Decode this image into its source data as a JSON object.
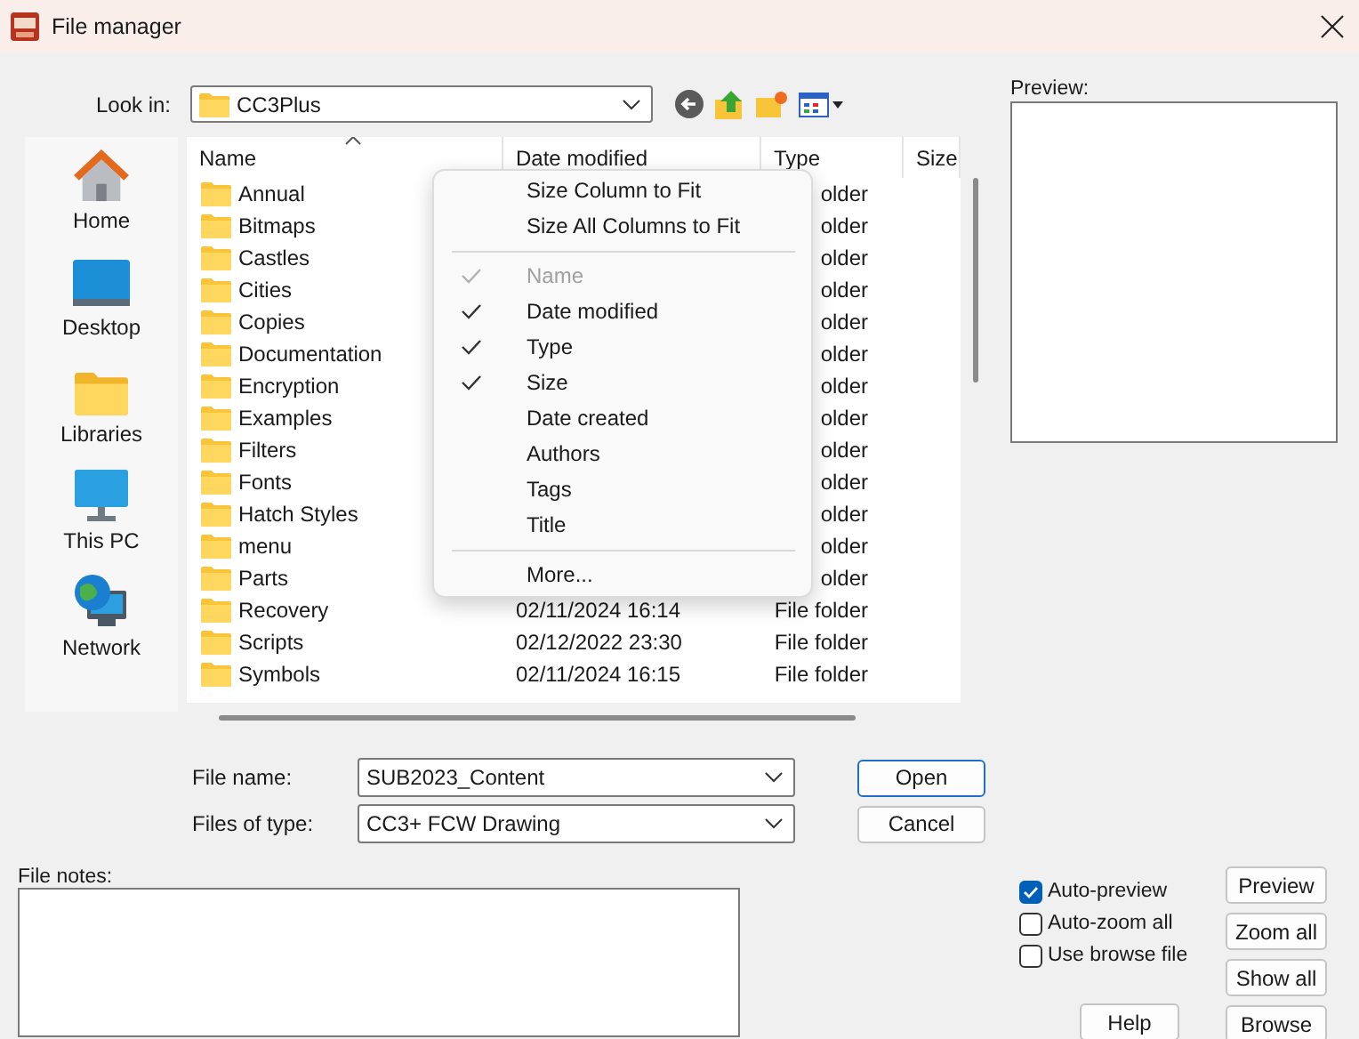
{
  "window": {
    "title": "File manager"
  },
  "look_in": {
    "label": "Look in:",
    "value": "CC3Plus"
  },
  "preview": {
    "label": "Preview:"
  },
  "places": [
    {
      "kind": "home",
      "label": "Home"
    },
    {
      "kind": "desktop",
      "label": "Desktop"
    },
    {
      "kind": "libraries",
      "label": "Libraries"
    },
    {
      "kind": "pc",
      "label": "This PC"
    },
    {
      "kind": "network",
      "label": "Network"
    }
  ],
  "file_list": {
    "columns": [
      {
        "label": "Name",
        "sorted": true
      },
      {
        "label": "Date modified",
        "sorted": false
      },
      {
        "label": "Type",
        "sorted": false
      },
      {
        "label": "Size",
        "sorted": false
      }
    ],
    "rows": [
      {
        "name": "Annual",
        "type": "older"
      },
      {
        "name": "Bitmaps",
        "type": "older"
      },
      {
        "name": "Castles",
        "type": "older"
      },
      {
        "name": "Cities",
        "type": "older"
      },
      {
        "name": "Copies",
        "type": "older"
      },
      {
        "name": "Documentation",
        "type": "older"
      },
      {
        "name": "Encryption",
        "type": "older"
      },
      {
        "name": "Examples",
        "type": "older"
      },
      {
        "name": "Filters",
        "type": "older"
      },
      {
        "name": "Fonts",
        "type": "older"
      },
      {
        "name": "Hatch Styles",
        "type": "older"
      },
      {
        "name": "menu",
        "type": "older"
      },
      {
        "name": "Parts",
        "type": "older"
      },
      {
        "name": "Recovery",
        "date": "02/11/2024 16:14",
        "type": "File folder"
      },
      {
        "name": "Scripts",
        "date": "02/12/2022 23:30",
        "type": "File folder"
      },
      {
        "name": "Symbols",
        "date": "02/11/2024 16:15",
        "type": "File folder"
      }
    ]
  },
  "context_menu": {
    "items": [
      {
        "kind": "action",
        "label": "Size Column to Fit"
      },
      {
        "kind": "action",
        "label": "Size All Columns to Fit"
      },
      {
        "kind": "separator"
      },
      {
        "kind": "toggle",
        "label": "Name",
        "checked": true,
        "disabled": true
      },
      {
        "kind": "toggle",
        "label": "Date modified",
        "checked": true,
        "disabled": false
      },
      {
        "kind": "toggle",
        "label": "Type",
        "checked": true,
        "disabled": false
      },
      {
        "kind": "toggle",
        "label": "Size",
        "checked": true,
        "disabled": false
      },
      {
        "kind": "toggle",
        "label": "Date created",
        "checked": false,
        "disabled": false
      },
      {
        "kind": "toggle",
        "label": "Authors",
        "checked": false,
        "disabled": false
      },
      {
        "kind": "toggle",
        "label": "Tags",
        "checked": false,
        "disabled": false
      },
      {
        "kind": "toggle",
        "label": "Title",
        "checked": false,
        "disabled": false
      },
      {
        "kind": "separator"
      },
      {
        "kind": "action",
        "label": "More..."
      }
    ]
  },
  "file_name": {
    "label": "File name:",
    "value": "SUB2023_Content"
  },
  "file_type": {
    "label": "Files of type:",
    "value": "CC3+ FCW Drawing"
  },
  "dialog_buttons": [
    {
      "label": "Open",
      "default": true
    },
    {
      "label": "Cancel",
      "default": false
    }
  ],
  "file_notes": {
    "label": "File notes:"
  },
  "options": [
    {
      "label": "Auto-preview",
      "checked": true
    },
    {
      "label": "Auto-zoom all",
      "checked": false
    },
    {
      "label": "Use browse file",
      "checked": false
    }
  ],
  "help_button": "Help",
  "side_buttons": [
    "Preview",
    "Zoom all",
    "Show all",
    "Browse"
  ]
}
